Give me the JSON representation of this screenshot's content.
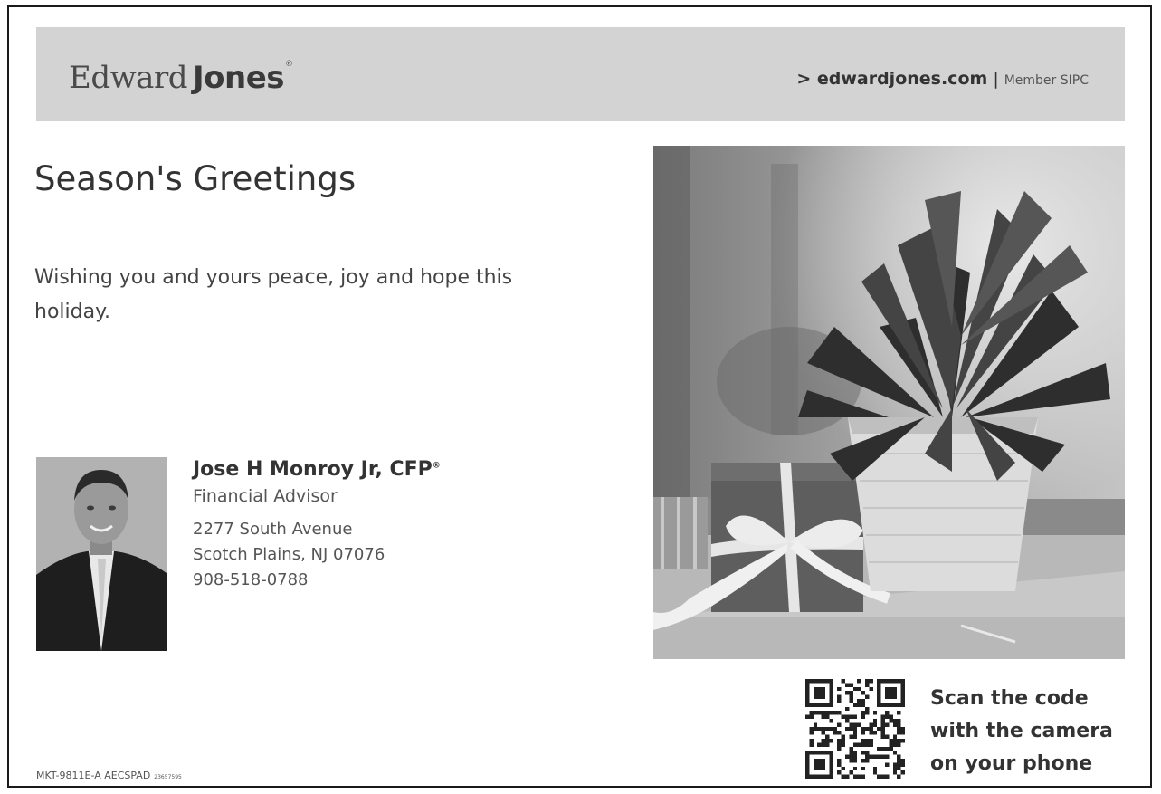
{
  "header": {
    "logo_text_1": "Edward",
    "logo_text_2": "Jones",
    "website": "> edwardjones.com",
    "separator": "|",
    "member": "Member SIPC"
  },
  "greeting": {
    "title": "Season's Greetings",
    "message": "Wishing you and yours peace, joy and hope this holiday."
  },
  "advisor": {
    "name": "Jose H Monroy Jr, CFP",
    "name_mark": "®",
    "role": "Financial Advisor",
    "address_line_1": "2277 South Avenue",
    "address_line_2": "Scotch Plains, NJ 07076",
    "phone": "908-518-0788"
  },
  "qr": {
    "line_1": "Scan the code",
    "line_2": "with the camera",
    "line_3": "on your phone"
  },
  "footer": {
    "code": "MKT-9811E-A  AECSPAD",
    "code_small": "23657595"
  },
  "icons": {
    "qr": "qr-code-icon",
    "photo": "advisor-photo",
    "scene": "poinsettia-gift-photo"
  },
  "colors": {
    "header_bg": "#d3d3d3",
    "text_dark": "#333333"
  }
}
